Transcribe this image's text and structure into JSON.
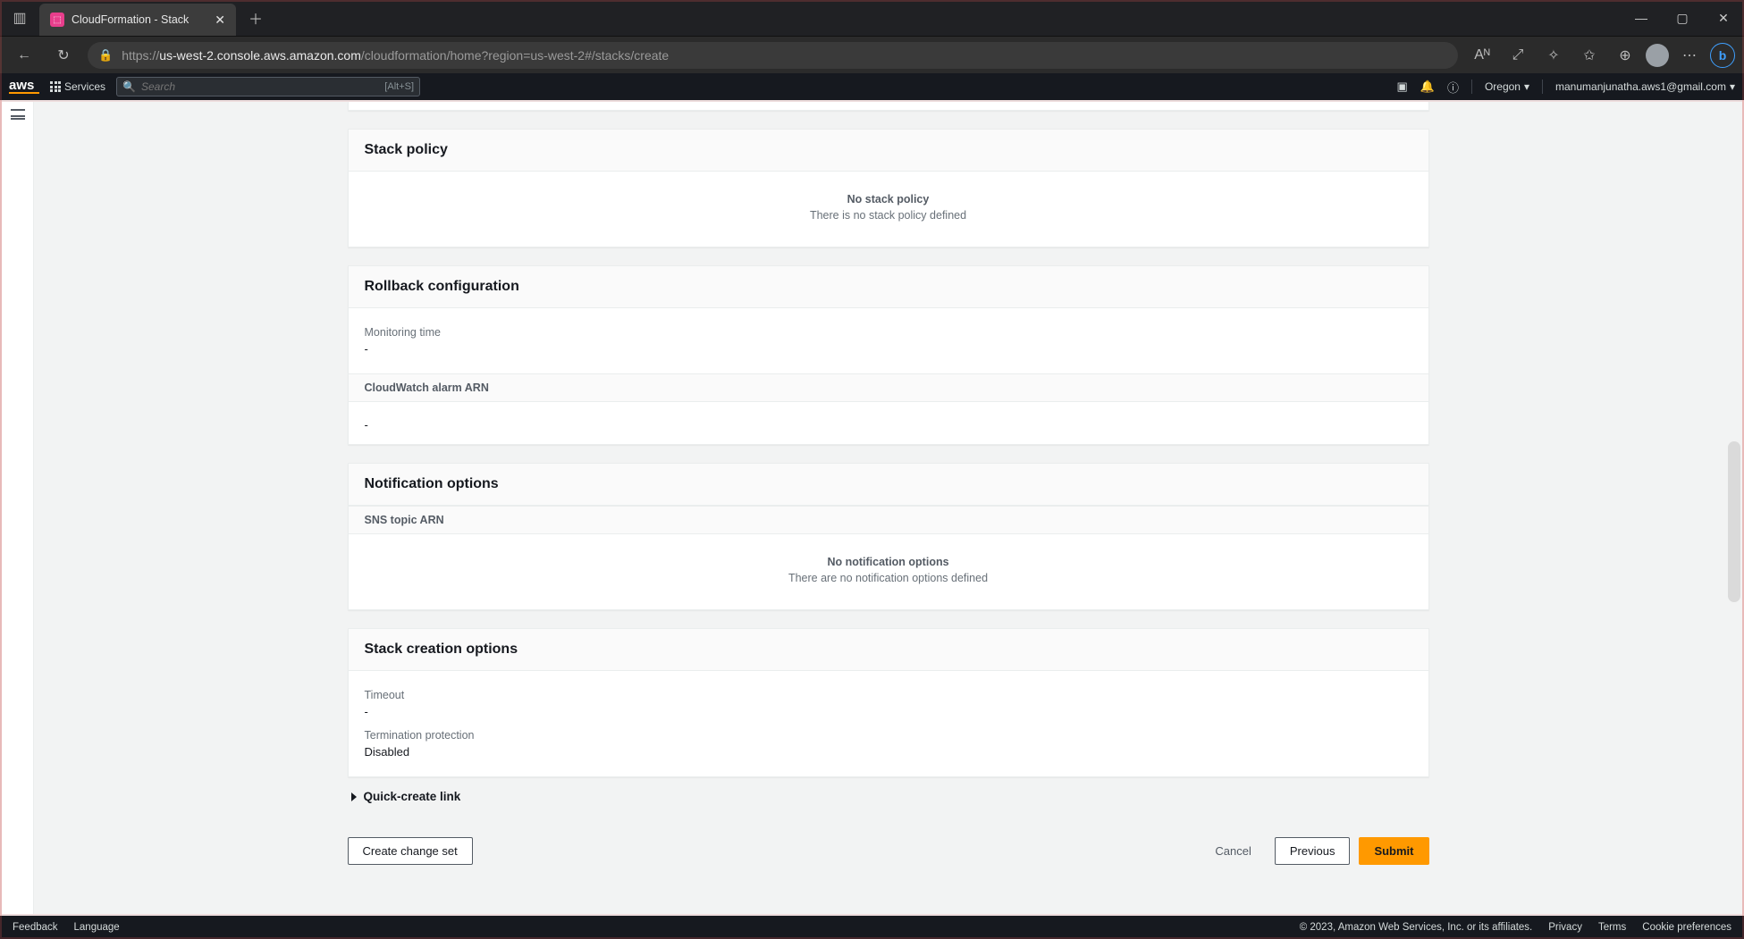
{
  "browser": {
    "tab_title": "CloudFormation - Stack",
    "url_host": "us-west-2.console.aws.amazon.com",
    "url_path": "/cloudformation/home?region=us-west-2#/stacks/create",
    "url_prefix": "https://",
    "addr_read_aloud": "Aᴺ"
  },
  "aws_nav": {
    "logo": "aws",
    "services": "Services",
    "search_placeholder": "Search",
    "search_kbd": "[Alt+S]",
    "region": "Oregon",
    "account": "manumanjunatha.aws1@gmail.com"
  },
  "panels": {
    "stack_policy": {
      "title": "Stack policy",
      "empty_title": "No stack policy",
      "empty_sub": "There is no stack policy defined"
    },
    "rollback": {
      "title": "Rollback configuration",
      "monitoring_label": "Monitoring time",
      "monitoring_value": "-",
      "alarm_header": "CloudWatch alarm ARN",
      "alarm_value": "-"
    },
    "notification": {
      "title": "Notification options",
      "sns_header": "SNS topic ARN",
      "empty_title": "No notification options",
      "empty_sub": "There are no notification options defined"
    },
    "creation": {
      "title": "Stack creation options",
      "timeout_label": "Timeout",
      "timeout_value": "-",
      "termination_label": "Termination protection",
      "termination_value": "Disabled"
    }
  },
  "quick_create": "Quick-create link",
  "buttons": {
    "create_change_set": "Create change set",
    "cancel": "Cancel",
    "previous": "Previous",
    "submit": "Submit"
  },
  "footer": {
    "feedback": "Feedback",
    "language": "Language",
    "copyright": "© 2023, Amazon Web Services, Inc. or its affiliates.",
    "privacy": "Privacy",
    "terms": "Terms",
    "cookies": "Cookie preferences"
  }
}
